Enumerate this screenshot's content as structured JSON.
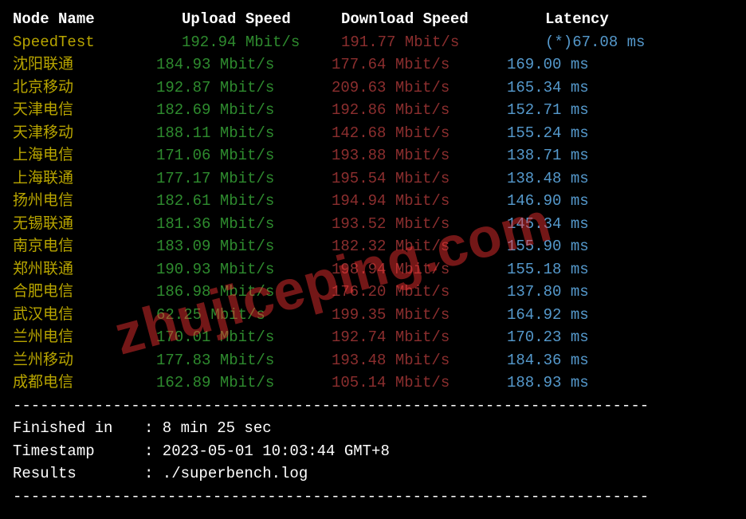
{
  "headers": {
    "node": "Node Name",
    "upload": "Upload Speed",
    "download": "Download Speed",
    "latency": "Latency"
  },
  "speedtest": {
    "name": "SpeedTest",
    "upload": "192.94 Mbit/s",
    "download": "191.77 Mbit/s",
    "latency": "(*)67.08 ms"
  },
  "rows": [
    {
      "node": "沈阳联通",
      "upload": "184.93 Mbit/s",
      "download": "177.64 Mbit/s",
      "latency": "169.00 ms"
    },
    {
      "node": "北京移动",
      "upload": "192.87 Mbit/s",
      "download": "209.63 Mbit/s",
      "latency": "165.34 ms"
    },
    {
      "node": "天津电信",
      "upload": "182.69 Mbit/s",
      "download": "192.86 Mbit/s",
      "latency": "152.71 ms"
    },
    {
      "node": "天津移动",
      "upload": "188.11 Mbit/s",
      "download": "142.68 Mbit/s",
      "latency": "155.24 ms"
    },
    {
      "node": "上海电信",
      "upload": "171.06 Mbit/s",
      "download": "193.88 Mbit/s",
      "latency": "138.71 ms"
    },
    {
      "node": "上海联通",
      "upload": "177.17 Mbit/s",
      "download": "195.54 Mbit/s",
      "latency": "138.48 ms"
    },
    {
      "node": "扬州电信",
      "upload": "182.61 Mbit/s",
      "download": "194.94 Mbit/s",
      "latency": "146.90 ms"
    },
    {
      "node": "无锡联通",
      "upload": "181.36 Mbit/s",
      "download": "193.52 Mbit/s",
      "latency": "145.34 ms"
    },
    {
      "node": "南京电信",
      "upload": "183.09 Mbit/s",
      "download": "182.32 Mbit/s",
      "latency": "155.90 ms"
    },
    {
      "node": "郑州联通",
      "upload": "190.93 Mbit/s",
      "download": "198.94 Mbit/s",
      "latency": "155.18 ms"
    },
    {
      "node": "合肥电信",
      "upload": "186.98 Mbit/s",
      "download": "176.20 Mbit/s",
      "latency": "137.80 ms"
    },
    {
      "node": "武汉电信",
      "upload": "62.25 Mbit/s",
      "download": "199.35 Mbit/s",
      "latency": "164.92 ms"
    },
    {
      "node": "兰州电信",
      "upload": "170.01 Mbit/s",
      "download": "192.74 Mbit/s",
      "latency": "170.23 ms"
    },
    {
      "node": "兰州移动",
      "upload": "177.83 Mbit/s",
      "download": "193.48 Mbit/s",
      "latency": "184.36 ms"
    },
    {
      "node": "成都电信",
      "upload": "162.89 Mbit/s",
      "download": "105.14 Mbit/s",
      "latency": "188.93 ms"
    }
  ],
  "divider": "----------------------------------------------------------------------",
  "footer": {
    "finished_label": "Finished in",
    "finished_value": ": 8 min 25 sec",
    "timestamp_label": "Timestamp",
    "timestamp_value": ": 2023-05-01 10:03:44 GMT+8",
    "results_label": "Results",
    "results_value": ": ./superbench.log"
  },
  "watermark": "zhujiceping.com"
}
